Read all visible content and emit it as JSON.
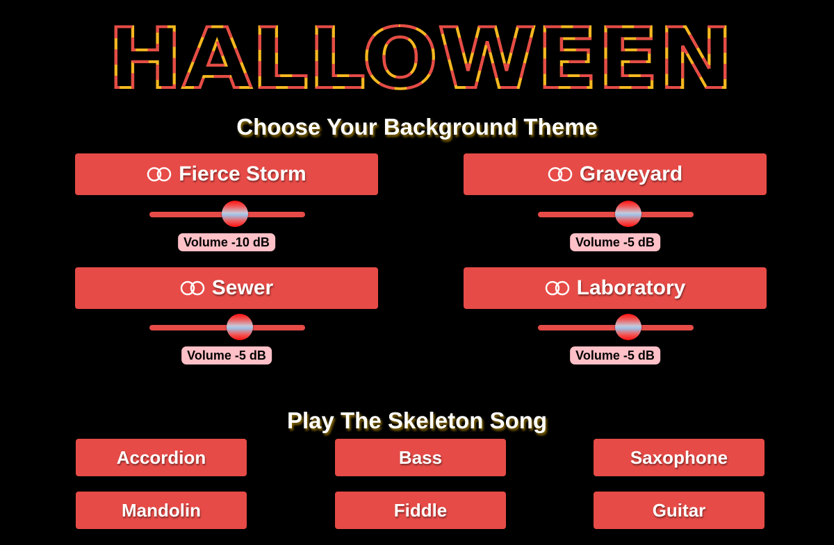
{
  "header": {
    "logo_text": "HALLOWEEN"
  },
  "background_section": {
    "title": "Choose Your Background Theme",
    "themes": [
      {
        "label": "Fierce Storm",
        "icon": "toggle-icon",
        "volume": -10,
        "volume_label": "Volume -10 dB"
      },
      {
        "label": "Graveyard",
        "icon": "toggle-icon",
        "volume": -5,
        "volume_label": "Volume -5 dB"
      },
      {
        "label": "Sewer",
        "icon": "toggle-icon",
        "volume": -5,
        "volume_label": "Volume -5 dB"
      },
      {
        "label": "Laboratory",
        "icon": "toggle-icon",
        "volume": -5,
        "volume_label": "Volume -5 dB"
      }
    ]
  },
  "song_section": {
    "title": "Play The Skeleton Song",
    "instruments": [
      "Accordion",
      "Bass",
      "Saxophone",
      "Mandolin",
      "Fiddle",
      "Guitar"
    ]
  },
  "colors": {
    "background": "#000000",
    "button": "#e64b47",
    "logo_red": "#e64b47",
    "logo_yellow": "#f5b820",
    "badge": "#ffc0c7"
  }
}
